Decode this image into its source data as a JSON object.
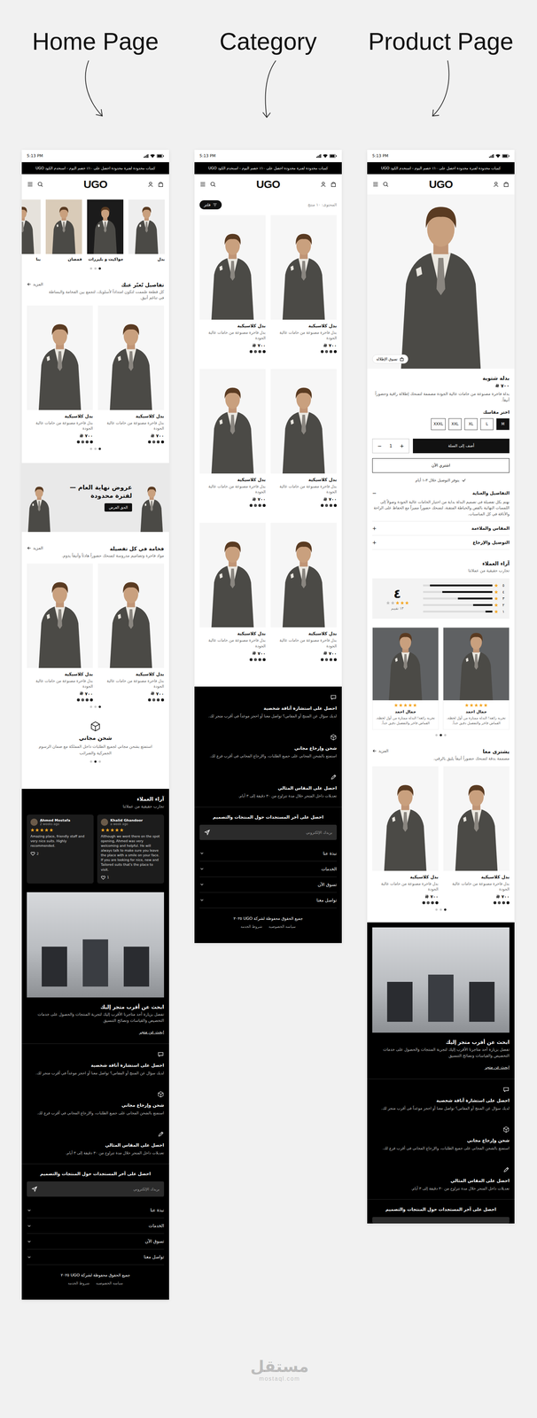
{
  "pages": [
    {
      "kind": "home",
      "heading": "Home Page",
      "time": "5:13 PM",
      "announcement": "كميات محدودة لفترة محدودة احصل على ١٠٪ خصم اليوم - استخدم الكود UGO",
      "logo": "UGO",
      "categories": [
        {
          "label": "بدل"
        },
        {
          "label": "جواكيت و بليزرات"
        },
        {
          "label": "قمصان"
        },
        {
          "label": "بنا"
        }
      ],
      "category_dots": [
        {
          "selected": true
        },
        {
          "selected": false
        },
        {
          "selected": false
        }
      ],
      "sections": [
        {
          "title": "تفاصيل تُعبّر عنك",
          "subtitle": "كل قطعة صُممت لتكون امتداداً لأسلوبك، لتجمع بين الفخامة والبساطة في تناغم أنيق.",
          "more": "المزيد",
          "products": [
            {
              "name": "بدل كلاسيكية",
              "desc": "بدل فاخرة مصنوعة من خامات عالية الجودة",
              "price": "٧٠٠",
              "swatches": [
                {
                  "color": "#111111"
                },
                {
                  "color": "#333333"
                },
                {
                  "color": "#4d4d4d"
                },
                {
                  "color": "#222222"
                }
              ]
            },
            {
              "name": "بدل كلاسيكية",
              "desc": "بدل فاخرة مصنوعة من خامات عالية الجودة",
              "price": "٧٠٠",
              "swatches": [
                {
                  "color": "#111111"
                },
                {
                  "color": "#333333"
                },
                {
                  "color": "#4d4d4d"
                },
                {
                  "color": "#222222"
                }
              ]
            }
          ],
          "dots": [
            {
              "selected": true
            },
            {
              "selected": false
            },
            {
              "selected": false
            }
          ]
        },
        {
          "title": "فخامة في كل تفصيلة",
          "subtitle": "مواد فاخرة وتصاميم مدروسة لتمنحك حضوراً هادئاً وأنيقاً يدوم.",
          "more": "المزيد",
          "products": [
            {
              "name": "بدل كلاسيكية",
              "desc": "بدل فاخرة مصنوعة من خامات عالية الجودة",
              "price": "٧٠٠",
              "swatches": [
                {
                  "color": "#111111"
                },
                {
                  "color": "#333333"
                },
                {
                  "color": "#4d4d4d"
                },
                {
                  "color": "#222222"
                }
              ]
            },
            {
              "name": "بدل كلاسيكية",
              "desc": "بدل فاخرة مصنوعة من خامات عالية الجودة",
              "price": "٧٠٠",
              "swatches": [
                {
                  "color": "#111111"
                },
                {
                  "color": "#333333"
                },
                {
                  "color": "#4d4d4d"
                },
                {
                  "color": "#222222"
                }
              ]
            }
          ],
          "dots": [
            {
              "selected": true
            },
            {
              "selected": false
            },
            {
              "selected": false
            }
          ]
        }
      ],
      "banner": {
        "title_lines": [
          "عروض نهاية العام —",
          "لفترة محدودة"
        ],
        "button": "الحق العرض"
      },
      "shipping": {
        "title": "شحن مجاني",
        "text": "استمتع بشحن مجاني لجميع الطلبات داخل المملكة مع ضمان الرسوم الجمركية والضرائب",
        "dots": [
          {
            "selected": false
          },
          {
            "selected": true
          },
          {
            "selected": false
          }
        ]
      },
      "footer": {
        "reviews": {
          "title": "آراء العملاء",
          "subtitle": "تجارب حقيقية من عملائنا",
          "cards": [
            {
              "name": "Khalid Ghandoor",
              "meta": "a week ago",
              "stars": 5,
              "text": "Although we went there on the spot opening, Ahmed was very welcoming and helpful. He will always talk to make sure you leave the place with a smile on your face. If you are looking for nice, new and Tailored suits that's the place to visit.",
              "likes": "1"
            },
            {
              "name": "Ahmed Mostafa",
              "meta": "2 weeks ago",
              "stars": 5,
              "text": "Amazing place, friendly staff and very nice suits. Highly recommended.",
              "likes": "2"
            }
          ]
        },
        "store": {
          "title": "ابحث عن أقرب متجر إليك",
          "text": "تفضل بزيارة أحد متاجرنا الأقرب إليك لتجربة المنتجات والحصول على خدمات التخصيص والقياسات ونصائح التنسيق",
          "link": "ابحث عن متجر"
        },
        "features": [
          {
            "title": "احصل على استشارة أناقة شخصية",
            "text": "لديك سؤال عن المنتج أو المقاس؟ تواصل معنا أو احجز موعداً في أقرب متجر لك."
          },
          {
            "title": "شحن وإرجاع مجاني",
            "text": "استمتع بالشحن المجاني على جميع الطلبات، والإرجاع المجاني في أقرب فرع لك."
          },
          {
            "title": "احصل على المقاس المثالي",
            "text": "تعديلات داخل المتجر خلال مدة تتراوح من ٣٠ دقيقة إلى ٣ أيام."
          }
        ],
        "newsletter": {
          "title": "احصل على آخر المستجدات حول المنتجات والتصميم",
          "placeholder": "بريدك الإلكتروني"
        },
        "links": [
          {
            "label": "نبذة عنا",
            "expanded": false
          },
          {
            "label": "الخدمات",
            "expanded": false
          },
          {
            "label": "تسوق الآن",
            "expanded": false
          },
          {
            "label": "تواصل معنا",
            "expanded": false
          }
        ],
        "copyright": "جميع الحقوق محفوظة لشركة UGO ٢٠٢٥",
        "legal": [
          "سياسة الخصوصية",
          "شروط الخدمة"
        ]
      }
    },
    {
      "kind": "category",
      "heading": "Category",
      "time": "5:13 PM",
      "announcement": "كميات محدودة لفترة محدودة احصل على ١٠٪ خصم اليوم - استخدم الكود UGO",
      "logo": "UGO",
      "filter": "فلتر",
      "count": "المحتوى: ١٠ منتج",
      "products": [
        {
          "name": "بدل كلاسيكية",
          "desc": "بدل فاخرة مصنوعة من خامات عالية الجودة",
          "price": "٧٠٠",
          "swatches": [
            {
              "color": "#111111"
            },
            {
              "color": "#333333"
            },
            {
              "color": "#4d4d4d"
            },
            {
              "color": "#222222"
            }
          ]
        },
        {
          "name": "بدل كلاسيكية",
          "desc": "بدل فاخرة مصنوعة من خامات عالية الجودة",
          "price": "٧٠٠",
          "swatches": [
            {
              "color": "#111111"
            },
            {
              "color": "#333333"
            },
            {
              "color": "#4d4d4d"
            },
            {
              "color": "#222222"
            }
          ]
        },
        {
          "name": "بدل كلاسيكية",
          "desc": "بدل فاخرة مصنوعة من خامات عالية الجودة",
          "price": "٧٠٠",
          "swatches": [
            {
              "color": "#111111"
            },
            {
              "color": "#333333"
            },
            {
              "color": "#4d4d4d"
            },
            {
              "color": "#222222"
            }
          ]
        },
        {
          "name": "بدل كلاسيكية",
          "desc": "بدل فاخرة مصنوعة من خامات عالية الجودة",
          "price": "٧٠٠",
          "swatches": [
            {
              "color": "#111111"
            },
            {
              "color": "#333333"
            },
            {
              "color": "#4d4d4d"
            },
            {
              "color": "#222222"
            }
          ]
        },
        {
          "name": "بدل كلاسيكية",
          "desc": "بدل فاخرة مصنوعة من خامات عالية الجودة",
          "price": "٧٠٠",
          "swatches": [
            {
              "color": "#111111"
            },
            {
              "color": "#333333"
            },
            {
              "color": "#4d4d4d"
            },
            {
              "color": "#222222"
            }
          ]
        },
        {
          "name": "بدل كلاسيكية",
          "desc": "بدل فاخرة مصنوعة من خامات عالية الجودة",
          "price": "٧٠٠",
          "swatches": [
            {
              "color": "#111111"
            },
            {
              "color": "#333333"
            },
            {
              "color": "#4d4d4d"
            },
            {
              "color": "#222222"
            }
          ]
        }
      ],
      "footer": {
        "features": [
          {
            "title": "احصل على استشارة أناقة شخصية",
            "text": "لديك سؤال عن المنتج أو المقاس؟ تواصل معنا أو احجز موعداً في أقرب متجر لك."
          },
          {
            "title": "شحن وإرجاع مجاني",
            "text": "استمتع بالشحن المجاني على جميع الطلبات، والإرجاع المجاني في أقرب فرع لك."
          },
          {
            "title": "احصل على المقاس المثالي",
            "text": "تعديلات داخل المتجر خلال مدة تتراوح من ٣٠ دقيقة إلى ٣ أيام."
          }
        ],
        "newsletter": {
          "title": "احصل على آخر المستجدات حول المنتجات والتصميم",
          "placeholder": "بريدك الإلكتروني"
        },
        "links": [
          {
            "label": "نبذة عنا",
            "expanded": false
          },
          {
            "label": "الخدمات",
            "expanded": false
          },
          {
            "label": "تسوق الآن",
            "expanded": false
          },
          {
            "label": "تواصل معنا",
            "expanded": false
          }
        ],
        "copyright": "جميع الحقوق محفوظة لشركة UGO ٢٠٢٥",
        "legal": [
          "سياسة الخصوصية",
          "شروط الخدمة"
        ]
      }
    },
    {
      "kind": "product",
      "heading": "Product Page",
      "time": "5:13 PM",
      "announcement": "كميات محدودة لفترة محدودة احصل على ١٠٪ خصم اليوم - استخدم الكود UGO",
      "logo": "UGO",
      "look_button": "تسوق الإطلالة",
      "title": "بدلة شتوية",
      "price": "٧٠٠",
      "desc": "بدلة فاخرة مصنوعة من خامات عالية الجودة مصممة لتمنحك إطلالة راقية وحضوراً أنيقاً.",
      "size_label": "اختر مقاسك",
      "sizes": [
        {
          "label": "M",
          "selected": true
        },
        {
          "label": "L",
          "selected": false
        },
        {
          "label": "XL",
          "selected": false
        },
        {
          "label": "XXL",
          "selected": false
        },
        {
          "label": "XXXL",
          "selected": false
        }
      ],
      "qty": {
        "minus": "−",
        "value": "1",
        "plus": "+"
      },
      "add_to_cart": "أضف إلى السلة",
      "buy_now": "اشتري الآن",
      "delivery": "يتوفر التوصيل خلال ٣-١ أيام",
      "accordion": [
        {
          "title": "التفاصيل والعناية",
          "expanded": true,
          "toggle": "−",
          "text": "نهتم بكل تفصيلة في تصميم البدلة بداية من اختيار الخامات عالية الجودة وصولاً إلى اللمسات النهائية بالقص والخياطة المتقنة، لتمنحك حضوراً مميزاً مع الحفاظ على الراحة والأناقة في كل المناسبات."
        },
        {
          "title": "المقاس والملاءمة",
          "expanded": false,
          "toggle": "+",
          "text": ""
        },
        {
          "title": "التوصيل والإرجاع",
          "expanded": false,
          "toggle": "+",
          "text": ""
        }
      ],
      "reviews": {
        "title": "آراء العملاء",
        "subtitle": "تجارب حقيقية من عملائنا",
        "score": "٤",
        "stars": 3,
        "count": "١٣ تقييم",
        "bars": [
          {
            "label": "٥",
            "level": 0.9
          },
          {
            "label": "٤",
            "level": 0.72
          },
          {
            "label": "٣",
            "level": 0.5
          },
          {
            "label": "٢",
            "level": 0.28
          },
          {
            "label": "١",
            "level": 0.1
          }
        ],
        "cards": [
          {
            "name": "جمال احمد",
            "stars": 5,
            "text": "تجربة رائعة! البدلة ممتازة من أول لحظة، القماش فاخر والتفصيل دقيق جداً."
          },
          {
            "name": "جمال احمد",
            "stars": 5,
            "text": "تجربة رائعة! البدلة ممتازة من أول لحظة، القماش فاخر والتفصيل دقيق جداً."
          }
        ],
        "dots": [
          {
            "selected": false
          },
          {
            "selected": true
          },
          {
            "selected": false
          }
        ]
      },
      "related": {
        "title": "يشترى معا",
        "subtitle": "مصممة بدقة لتمنحك حضوراً أنيقاً يليق بالرقي.",
        "more": "المزيد",
        "products": [
          {
            "name": "بدل كلاسيكية",
            "desc": "بدل فاخرة مصنوعة من خامات عالية الجودة",
            "price": "٧٠٠",
            "swatches": [
              {
                "color": "#111111"
              },
              {
                "color": "#333333"
              },
              {
                "color": "#4d4d4d"
              },
              {
                "color": "#222222"
              }
            ]
          },
          {
            "name": "بدل كلاسيكية",
            "desc": "بدل فاخرة مصنوعة من خامات عالية الجودة",
            "price": "٧٠٠",
            "swatches": [
              {
                "color": "#111111"
              },
              {
                "color": "#333333"
              },
              {
                "color": "#4d4d4d"
              },
              {
                "color": "#222222"
              }
            ]
          }
        ],
        "dots": [
          {
            "selected": true
          },
          {
            "selected": false
          },
          {
            "selected": false
          }
        ]
      },
      "footer": {
        "store": {
          "title": "ابحث عن أقرب متجر إليك",
          "text": "تفضل بزيارة أحد متاجرنا الأقرب إليك لتجربة المنتجات والحصول على خدمات التخصيص والقياسات ونصائح التنسيق",
          "link": "ابحث عن متجر"
        },
        "features": [
          {
            "title": "احصل على استشارة أناقة شخصية",
            "text": "لديك سؤال عن المنتج أو المقاس؟ تواصل معنا أو احجز موعداً في أقرب متجر لك."
          },
          {
            "title": "شحن وإرجاع مجاني",
            "text": "استمتع بالشحن المجاني على جميع الطلبات، والإرجاع المجاني في أقرب فرع لك."
          },
          {
            "title": "احصل على المقاس المثالي",
            "text": "تعديلات داخل المتجر خلال مدة تتراوح من ٣٠ دقيقة إلى ٣ أيام."
          }
        ],
        "newsletter": {
          "title": "احصل على آخر المستجدات حول المنتجات والتصميم"
        }
      }
    }
  ],
  "watermark": {
    "name": "مستقل",
    "site": "mostaql.com"
  }
}
